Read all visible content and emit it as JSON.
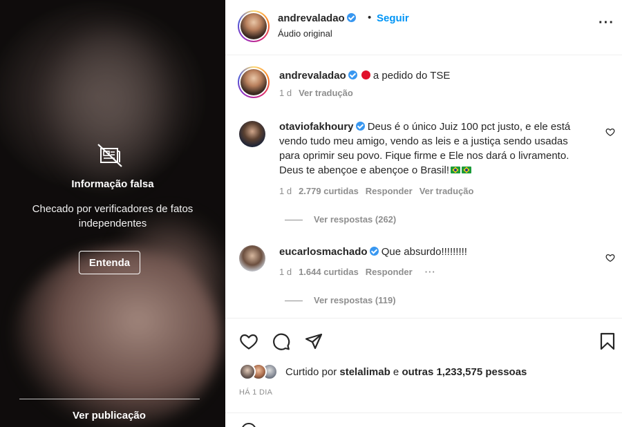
{
  "media": {
    "warning_title": "Informação falsa",
    "warning_desc": "Checado por verificadores de fatos independentes",
    "understand_button": "Entenda",
    "view_post": "Ver publicação"
  },
  "header": {
    "username": "andrevaladao",
    "dot": "•",
    "follow": "Seguir",
    "audio": "Áudio original",
    "more": "···"
  },
  "caption": {
    "username": "andrevaladao",
    "text": "a pedido do TSE",
    "time": "1 d",
    "translate": "Ver tradução"
  },
  "comments": [
    {
      "username": "otaviofakhoury",
      "text": "Deus é o único Juiz 100 pct justo, e ele está vendo tudo meu amigo, vendo as leis e a justiça sendo usadas para oprimir seu povo. Fique firme e Ele nos dará o livramento. Deus te abençoe e abençoe o Brasil!",
      "time": "1 d",
      "likes": "2.779 curtidas",
      "reply": "Responder",
      "translate": "Ver tradução",
      "view_replies": "Ver respostas (262)"
    },
    {
      "username": "eucarlosmachado",
      "text": "Que absurdo!!!!!!!!!",
      "time": "1 d",
      "likes": "1.644 curtidas",
      "reply": "Responder",
      "more": "···",
      "view_replies": "Ver respostas (119)"
    }
  ],
  "likes": {
    "prefix": "Curtido por",
    "user": "stelalimab",
    "mid": "e",
    "others": "outras 1,233,575 pessoas"
  },
  "timestamp": "HÁ 1 DIA",
  "icons": {
    "heart": "heart-icon",
    "comment": "comment-icon",
    "share": "share-icon",
    "save": "bookmark-icon"
  }
}
